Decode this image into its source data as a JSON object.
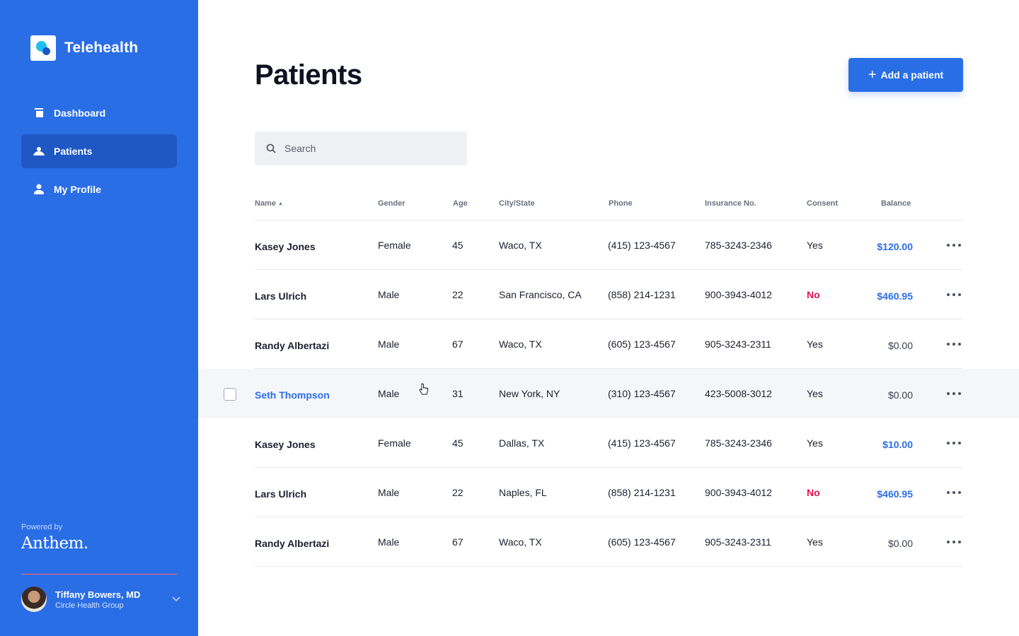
{
  "app": {
    "name": "Telehealth"
  },
  "sidebar": {
    "items": [
      {
        "label": "Dashboard",
        "icon": "dashboard-icon"
      },
      {
        "label": "Patients",
        "icon": "patients-icon",
        "active": true
      },
      {
        "label": "My Profile",
        "icon": "profile-icon"
      }
    ],
    "powered_by": "Powered by",
    "partner": "Anthem."
  },
  "user": {
    "name": "Tiffany Bowers, MD",
    "org": "Circle Health Group"
  },
  "header": {
    "title": "Patients",
    "add_button": "Add a patient"
  },
  "search": {
    "placeholder": "Search"
  },
  "table": {
    "columns": [
      "Name",
      "Gender",
      "Age",
      "City/State",
      "Phone",
      "Insurance No.",
      "Consent",
      "Balance"
    ],
    "sort_indicator": "▲",
    "rows": [
      {
        "name": "Kasey Jones",
        "gender": "Female",
        "age": "45",
        "city": "Waco, TX",
        "phone": "(415) 123-4567",
        "insurance": "785-3243-2346",
        "consent": "Yes",
        "balance": "$120.00",
        "balance_style": "blue"
      },
      {
        "name": "Lars Ulrich",
        "gender": "Male",
        "age": "22",
        "city": "San Francisco, CA",
        "phone": "(858) 214-1231",
        "insurance": "900-3943-4012",
        "consent": "No",
        "balance": "$460.95",
        "balance_style": "blue"
      },
      {
        "name": "Randy Albertazi",
        "gender": "Male",
        "age": "67",
        "city": "Waco, TX",
        "phone": "(605) 123-4567",
        "insurance": "905-3243-2311",
        "consent": "Yes",
        "balance": "$0.00",
        "balance_style": "gray"
      },
      {
        "name": "Seth Thompson",
        "gender": "Male",
        "age": "31",
        "city": "New York, NY",
        "phone": "(310) 123-4567",
        "insurance": "423-5008-3012",
        "consent": "Yes",
        "balance": "$0.00",
        "balance_style": "gray",
        "hovered": true
      },
      {
        "name": "Kasey Jones",
        "gender": "Female",
        "age": "45",
        "city": "Dallas, TX",
        "phone": "(415) 123-4567",
        "insurance": "785-3243-2346",
        "consent": "Yes",
        "balance": "$10.00",
        "balance_style": "blue"
      },
      {
        "name": "Lars Ulrich",
        "gender": "Male",
        "age": "22",
        "city": "Naples, FL",
        "phone": "(858) 214-1231",
        "insurance": "900-3943-4012",
        "consent": "No",
        "balance": "$460.95",
        "balance_style": "blue"
      },
      {
        "name": "Randy Albertazi",
        "gender": "Male",
        "age": "67",
        "city": "Waco, TX",
        "phone": "(605) 123-4567",
        "insurance": "905-3243-2311",
        "consent": "Yes",
        "balance": "$0.00",
        "balance_style": "gray"
      }
    ]
  },
  "colors": {
    "primary": "#2a6ee6",
    "danger": "#e5134d",
    "sidebar_active": "#1f58c4"
  }
}
